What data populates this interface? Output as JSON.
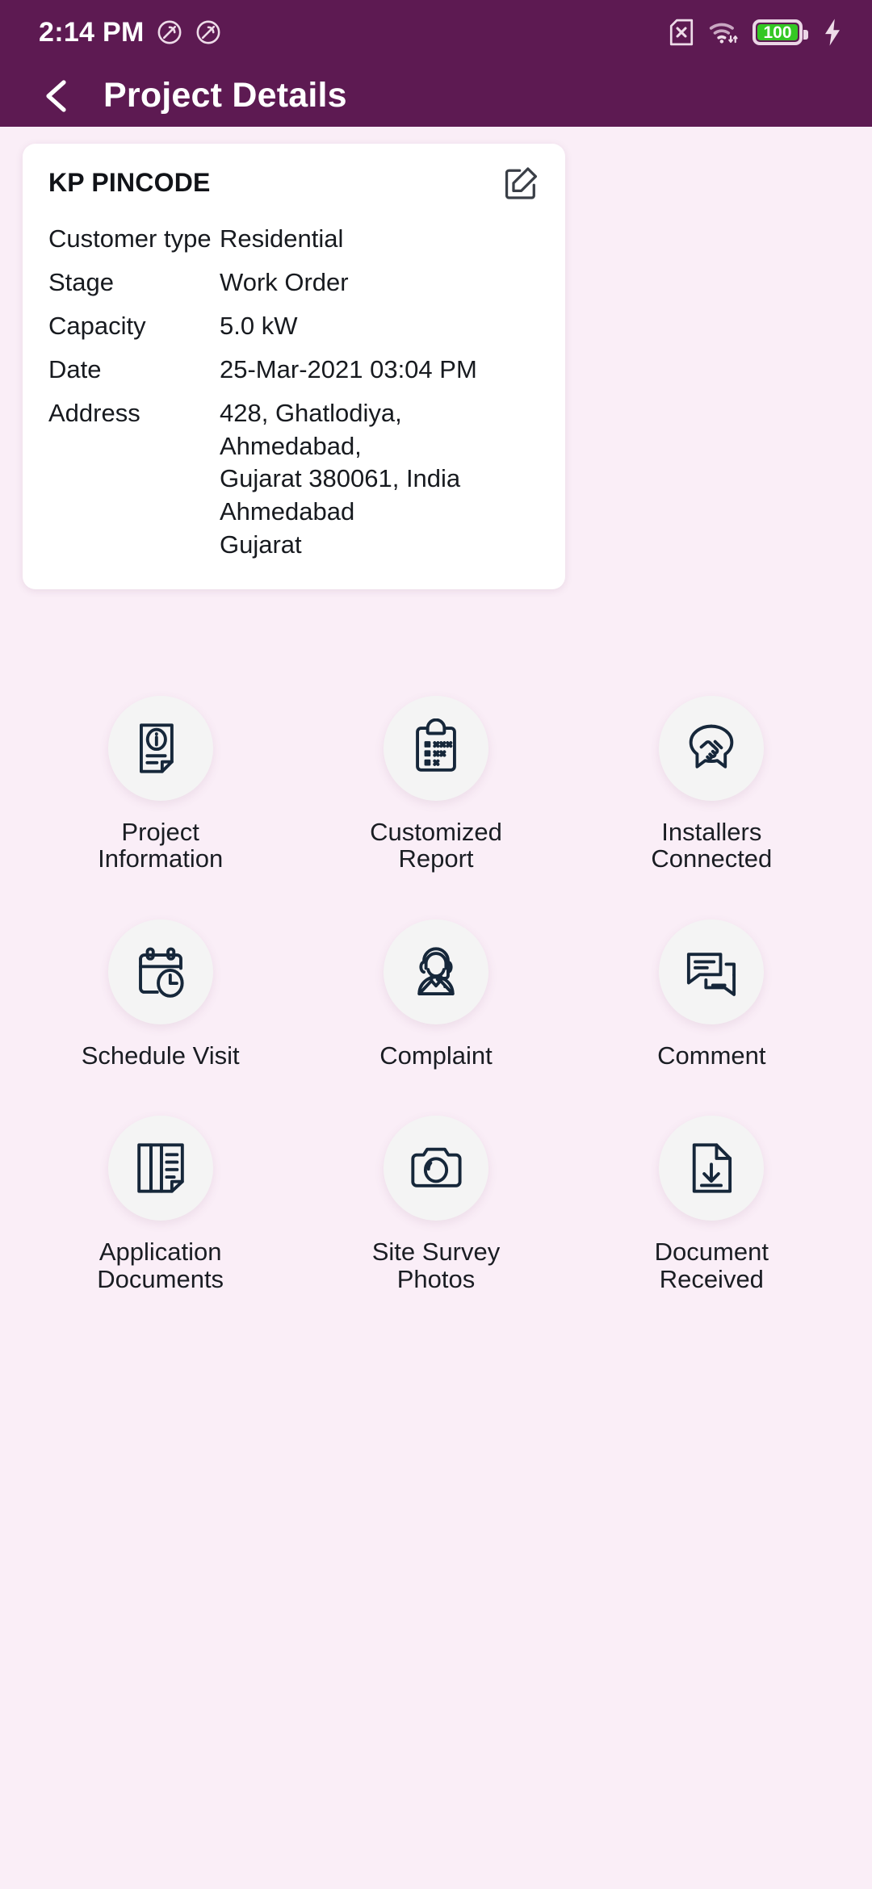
{
  "status_bar": {
    "time": "2:14 PM",
    "battery_percent": "100",
    "icons": [
      "dnd-icon",
      "dnd-icon",
      "no-sim-icon",
      "wifi-icon",
      "battery-icon",
      "charging-bolt-icon"
    ],
    "colors": {
      "background": "#5D1A52",
      "battery_fill": "#34C724"
    }
  },
  "app_bar": {
    "back_label": "back-chevron-icon",
    "title": "Project Details"
  },
  "card": {
    "title": "KP PINCODE",
    "edit_icon": "edit-pencil-icon",
    "rows": [
      {
        "label": "Customer type",
        "value": "Residential"
      },
      {
        "label": "Stage",
        "value": "Work Order"
      },
      {
        "label": "Capacity",
        "value": "5.0 kW"
      },
      {
        "label": "Date",
        "value": "25-Mar-2021 03:04 PM"
      },
      {
        "label": "Address",
        "value": "428, Ghatlodiya, Ahmedabad,\nGujarat 380061, India Ahmedabad\nGujarat"
      }
    ]
  },
  "grid": {
    "tiles": [
      {
        "label": "Project\nInformation",
        "icon": "document-info-icon"
      },
      {
        "label": "Customized\nReport",
        "icon": "clipboard-checklist-icon"
      },
      {
        "label": "Installers\nConnected",
        "icon": "handshake-icon"
      },
      {
        "label": "Schedule Visit",
        "icon": "calendar-clock-icon"
      },
      {
        "label": "Complaint",
        "icon": "headset-agent-icon"
      },
      {
        "label": "Comment",
        "icon": "chat-bubbles-icon"
      },
      {
        "label": "Application\nDocuments",
        "icon": "documents-stack-icon"
      },
      {
        "label": "Site Survey\nPhotos",
        "icon": "camera-icon"
      },
      {
        "label": "Document\nReceived",
        "icon": "document-download-icon"
      }
    ]
  },
  "theme": {
    "page_background": "#FAEEF7",
    "primary": "#5D1A52",
    "icon_stroke": "#16273A",
    "circle_background": "#F4F4F4"
  }
}
